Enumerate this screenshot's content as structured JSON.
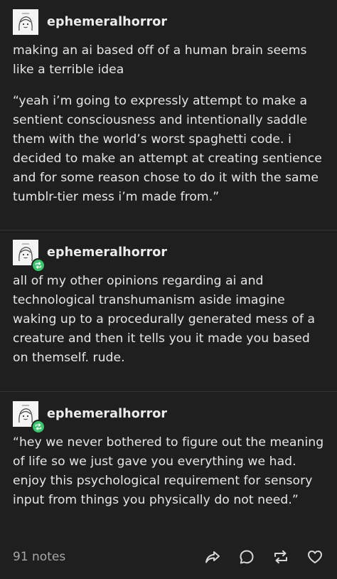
{
  "posts": [
    {
      "username": "ephemeralhorror",
      "reblogged": false,
      "paragraphs": [
        "making an ai based off of a human brain seems like a terrible idea",
        "“yeah i’m going to expressly attempt to make a sentient consciousness and intentionally saddle them with the world’s worst spaghetti code. i decided to make an attempt at creating sentience and for some reason chose to do it with the same tumblr-tier mess i’m made from.”"
      ]
    },
    {
      "username": "ephemeralhorror",
      "reblogged": true,
      "paragraphs": [
        "all of my other opinions regarding ai and technological transhumanism aside imagine waking up to a procedurally generated mess of a creature and then it tells you it made you based on themself. rude."
      ]
    },
    {
      "username": "ephemeralhorror",
      "reblogged": true,
      "paragraphs": [
        "“hey we never bothered to figure out the meaning of life so we just gave you everything we had. enjoy this psychological requirement for sensory input from things you physically do not need.”"
      ]
    }
  ],
  "footer": {
    "notes": "91 notes",
    "icons": [
      "share-icon",
      "reply-icon",
      "reblog-icon",
      "like-icon"
    ]
  },
  "colors": {
    "background": "#1f1f1f",
    "text": "#e6e6e6",
    "muted": "#a7a7a7",
    "reblog_badge": "#38c66b",
    "divider": "#343434"
  }
}
